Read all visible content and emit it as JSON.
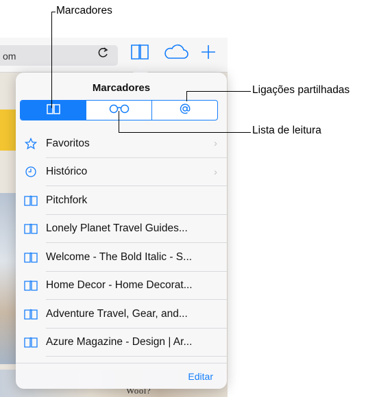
{
  "browser": {
    "url_fragment": "om",
    "reload_icon": "reload-icon",
    "toolbar_icons": [
      "bookmarks-icon",
      "icloud-icon",
      "plus-icon"
    ]
  },
  "background_text": {
    "wool": "Wool?"
  },
  "popover": {
    "title": "Marcadores",
    "segments": [
      {
        "icon": "book-icon",
        "active": true
      },
      {
        "icon": "glasses-icon",
        "active": false
      },
      {
        "icon": "at-icon",
        "active": false
      }
    ],
    "items": [
      {
        "icon": "star-icon",
        "label": "Favoritos",
        "chevron": true
      },
      {
        "icon": "clock-icon",
        "label": "Histórico",
        "chevron": true
      },
      {
        "icon": "book-icon",
        "label": "Pitchfork",
        "chevron": false
      },
      {
        "icon": "book-icon",
        "label": "Lonely Planet Travel Guides...",
        "chevron": false
      },
      {
        "icon": "book-icon",
        "label": "Welcome - The Bold Italic - S...",
        "chevron": false
      },
      {
        "icon": "book-icon",
        "label": "Home Decor - Home Decorat...",
        "chevron": false
      },
      {
        "icon": "book-icon",
        "label": "Adventure Travel, Gear, and...",
        "chevron": false
      },
      {
        "icon": "book-icon",
        "label": "Azure Magazine - Design | Ar...",
        "chevron": false
      }
    ],
    "edit_label": "Editar"
  },
  "callouts": {
    "top": "Marcadores",
    "shared_links": "Ligações partilhadas",
    "reading_list": "Lista de leitura"
  },
  "colors": {
    "accent": "#157efb",
    "separator": "#d9d9dd"
  }
}
